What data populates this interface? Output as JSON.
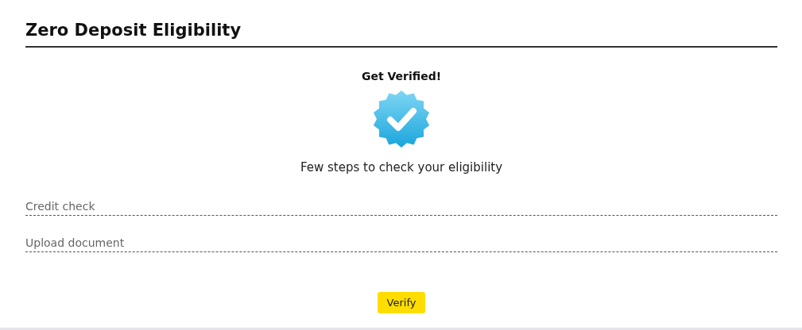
{
  "title": "Zero Deposit Eligibility",
  "heading": "Get Verified!",
  "subtitle": "Few steps to check your eligibility",
  "steps": [
    {
      "label": "Credit check"
    },
    {
      "label": "Upload document"
    }
  ],
  "button": "Verify"
}
